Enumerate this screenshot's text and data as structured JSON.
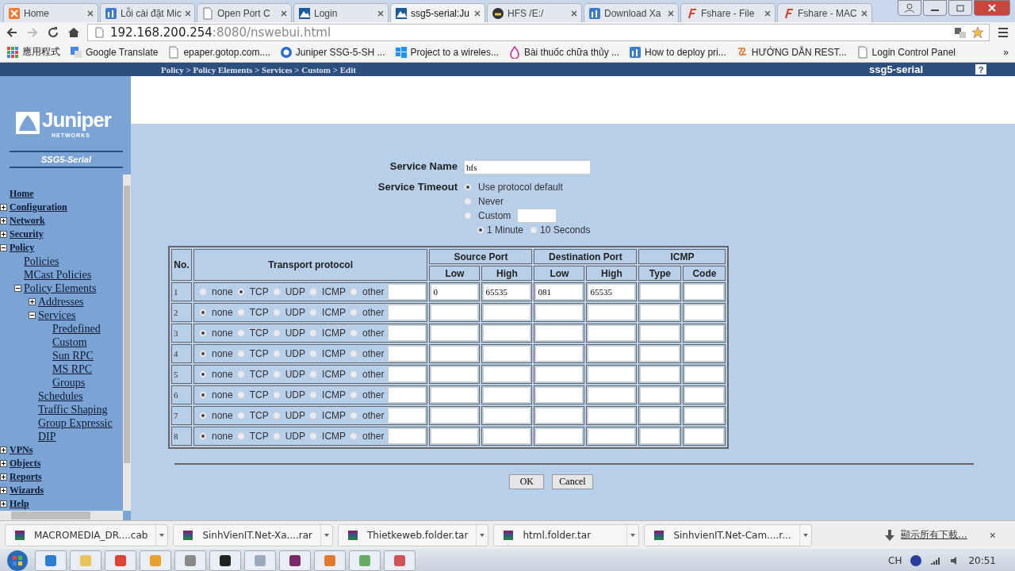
{
  "browser": {
    "tabs": [
      {
        "title": "Home",
        "selected": false
      },
      {
        "title": "Lỗi cài đặt Mic",
        "selected": false
      },
      {
        "title": "Open Port C",
        "selected": false
      },
      {
        "title": "Login",
        "selected": false
      },
      {
        "title": "ssg5-serial:Ju",
        "selected": true
      },
      {
        "title": "HFS /E:/",
        "selected": false
      },
      {
        "title": "Download Xa",
        "selected": false
      },
      {
        "title": "Fshare - File",
        "selected": false
      },
      {
        "title": "Fshare - MAC",
        "selected": false
      }
    ],
    "address": {
      "host": "192.168.200.254",
      "rest": ":8080/nswebui.html"
    },
    "bookmarks": [
      {
        "label": "應用程式"
      },
      {
        "label": "Google Translate"
      },
      {
        "label": "epaper.gotop.com...."
      },
      {
        "label": "Juniper SSG-5-SH ..."
      },
      {
        "label": "Project to a wireles..."
      },
      {
        "label": "Bài thuốc chữa thủy ..."
      },
      {
        "label": "How to deploy pri..."
      },
      {
        "label": "HƯỚNG DẪN REST..."
      },
      {
        "label": "Login Control Panel"
      }
    ],
    "bookmarks_more": "»"
  },
  "app": {
    "breadcrumb": "Policy > Policy Elements > Services > Custom > Edit",
    "device": "ssg5-serial",
    "help": "?",
    "logo": {
      "name": "Juniper",
      "sub": "NETWORKS"
    },
    "model": "SSG5-Serial",
    "menu": [
      {
        "label": "Home"
      },
      {
        "label": "Configuration",
        "expanded": false
      },
      {
        "label": "Network",
        "expanded": false
      },
      {
        "label": "Security",
        "expanded": false
      },
      {
        "label": "Policy",
        "expanded": true,
        "children": [
          {
            "label": "Policies"
          },
          {
            "label": "MCast Policies"
          },
          {
            "label": "Policy Elements",
            "expanded": true,
            "children": [
              {
                "label": "Addresses",
                "expanded": false
              },
              {
                "label": "Services",
                "expanded": true,
                "children": [
                  {
                    "label": "Predefined"
                  },
                  {
                    "label": "Custom"
                  },
                  {
                    "label": "Sun RPC"
                  },
                  {
                    "label": "MS RPC"
                  },
                  {
                    "label": "Groups"
                  }
                ]
              },
              {
                "label": "Schedules"
              },
              {
                "label": "Traffic Shaping"
              },
              {
                "label": "Group Expressic"
              },
              {
                "label": "DIP"
              }
            ]
          }
        ]
      },
      {
        "label": "VPNs",
        "expanded": false
      },
      {
        "label": "Objects",
        "expanded": false
      },
      {
        "label": "Reports",
        "expanded": false
      },
      {
        "label": "Wizards",
        "expanded": false
      },
      {
        "label": "Help",
        "expanded": false
      }
    ]
  },
  "form": {
    "service_name": {
      "label": "Service Name",
      "value": "hfs"
    },
    "service_timeout": {
      "label": "Service Timeout",
      "options": [
        {
          "label": "Use protocol default",
          "selected": true
        },
        {
          "label": "Never",
          "selected": false
        },
        {
          "label": "Custom",
          "selected": false,
          "kind": "field"
        }
      ],
      "units": [
        {
          "label": "1 Minute",
          "selected": true
        },
        {
          "label": "10 Seconds",
          "selected": false
        }
      ]
    }
  },
  "table": {
    "headers": {
      "no": "No.",
      "transport": "Transport protocol",
      "source": "Source Port",
      "destination": "Destination Port",
      "icmp": "ICMP",
      "source_low": "Low",
      "source_high": "High",
      "destination_low": "Low",
      "destination_high": "High",
      "type": "Type",
      "code": "Code"
    },
    "rows": [
      {
        "no": "1",
        "protocols": [
          {
            "label": "none",
            "selected": false
          },
          {
            "label": "TCP",
            "selected": true
          },
          {
            "label": "UDP",
            "selected": false
          },
          {
            "label": "ICMP",
            "selected": false
          },
          {
            "label": "other",
            "selected": false
          }
        ],
        "ports": [
          "0",
          "65535",
          "081",
          "65535"
        ]
      },
      {
        "no": "2",
        "protocols": [
          {
            "label": "none",
            "selected": true
          },
          {
            "label": "TCP",
            "selected": false
          },
          {
            "label": "UDP",
            "selected": false
          },
          {
            "label": "ICMP",
            "selected": false
          },
          {
            "label": "other",
            "selected": false
          }
        ]
      },
      {
        "no": "3",
        "protocols": [
          {
            "label": "none",
            "selected": true
          },
          {
            "label": "TCP",
            "selected": false
          },
          {
            "label": "UDP",
            "selected": false
          },
          {
            "label": "ICMP",
            "selected": false
          },
          {
            "label": "other",
            "selected": false
          }
        ]
      },
      {
        "no": "4",
        "protocols": [
          {
            "label": "none",
            "selected": true
          },
          {
            "label": "TCP",
            "selected": false
          },
          {
            "label": "UDP",
            "selected": false
          },
          {
            "label": "ICMP",
            "selected": false
          },
          {
            "label": "other",
            "selected": false
          }
        ]
      },
      {
        "no": "5",
        "protocols": [
          {
            "label": "none",
            "selected": true
          },
          {
            "label": "TCP",
            "selected": false
          },
          {
            "label": "UDP",
            "selected": false
          },
          {
            "label": "ICMP",
            "selected": false
          },
          {
            "label": "other",
            "selected": false
          }
        ]
      },
      {
        "no": "6",
        "protocols": [
          {
            "label": "none",
            "selected": true
          },
          {
            "label": "TCP",
            "selected": false
          },
          {
            "label": "UDP",
            "selected": false
          },
          {
            "label": "ICMP",
            "selected": false
          },
          {
            "label": "other",
            "selected": false
          }
        ]
      },
      {
        "no": "7",
        "protocols": [
          {
            "label": "none",
            "selected": true
          },
          {
            "label": "TCP",
            "selected": false
          },
          {
            "label": "UDP",
            "selected": false
          },
          {
            "label": "ICMP",
            "selected": false
          },
          {
            "label": "other",
            "selected": false
          }
        ]
      },
      {
        "no": "8",
        "protocols": [
          {
            "label": "none",
            "selected": true
          },
          {
            "label": "TCP",
            "selected": false
          },
          {
            "label": "UDP",
            "selected": false
          },
          {
            "label": "ICMP",
            "selected": false
          },
          {
            "label": "other",
            "selected": false
          }
        ]
      }
    ]
  },
  "buttons": [
    "OK",
    "Cancel"
  ],
  "downloads": {
    "items": [
      "MACROMEDIA_DR....cab",
      "SinhVienIT.Net-Xa....rar",
      "Thietkeweb.folder.tar",
      "html.folder.tar",
      "SinhvienIT.Net-Cam....r..."
    ],
    "show_all": "顯示所有下載...",
    "close": "×"
  },
  "taskbar": {
    "language": "CH",
    "time": "20:51"
  }
}
